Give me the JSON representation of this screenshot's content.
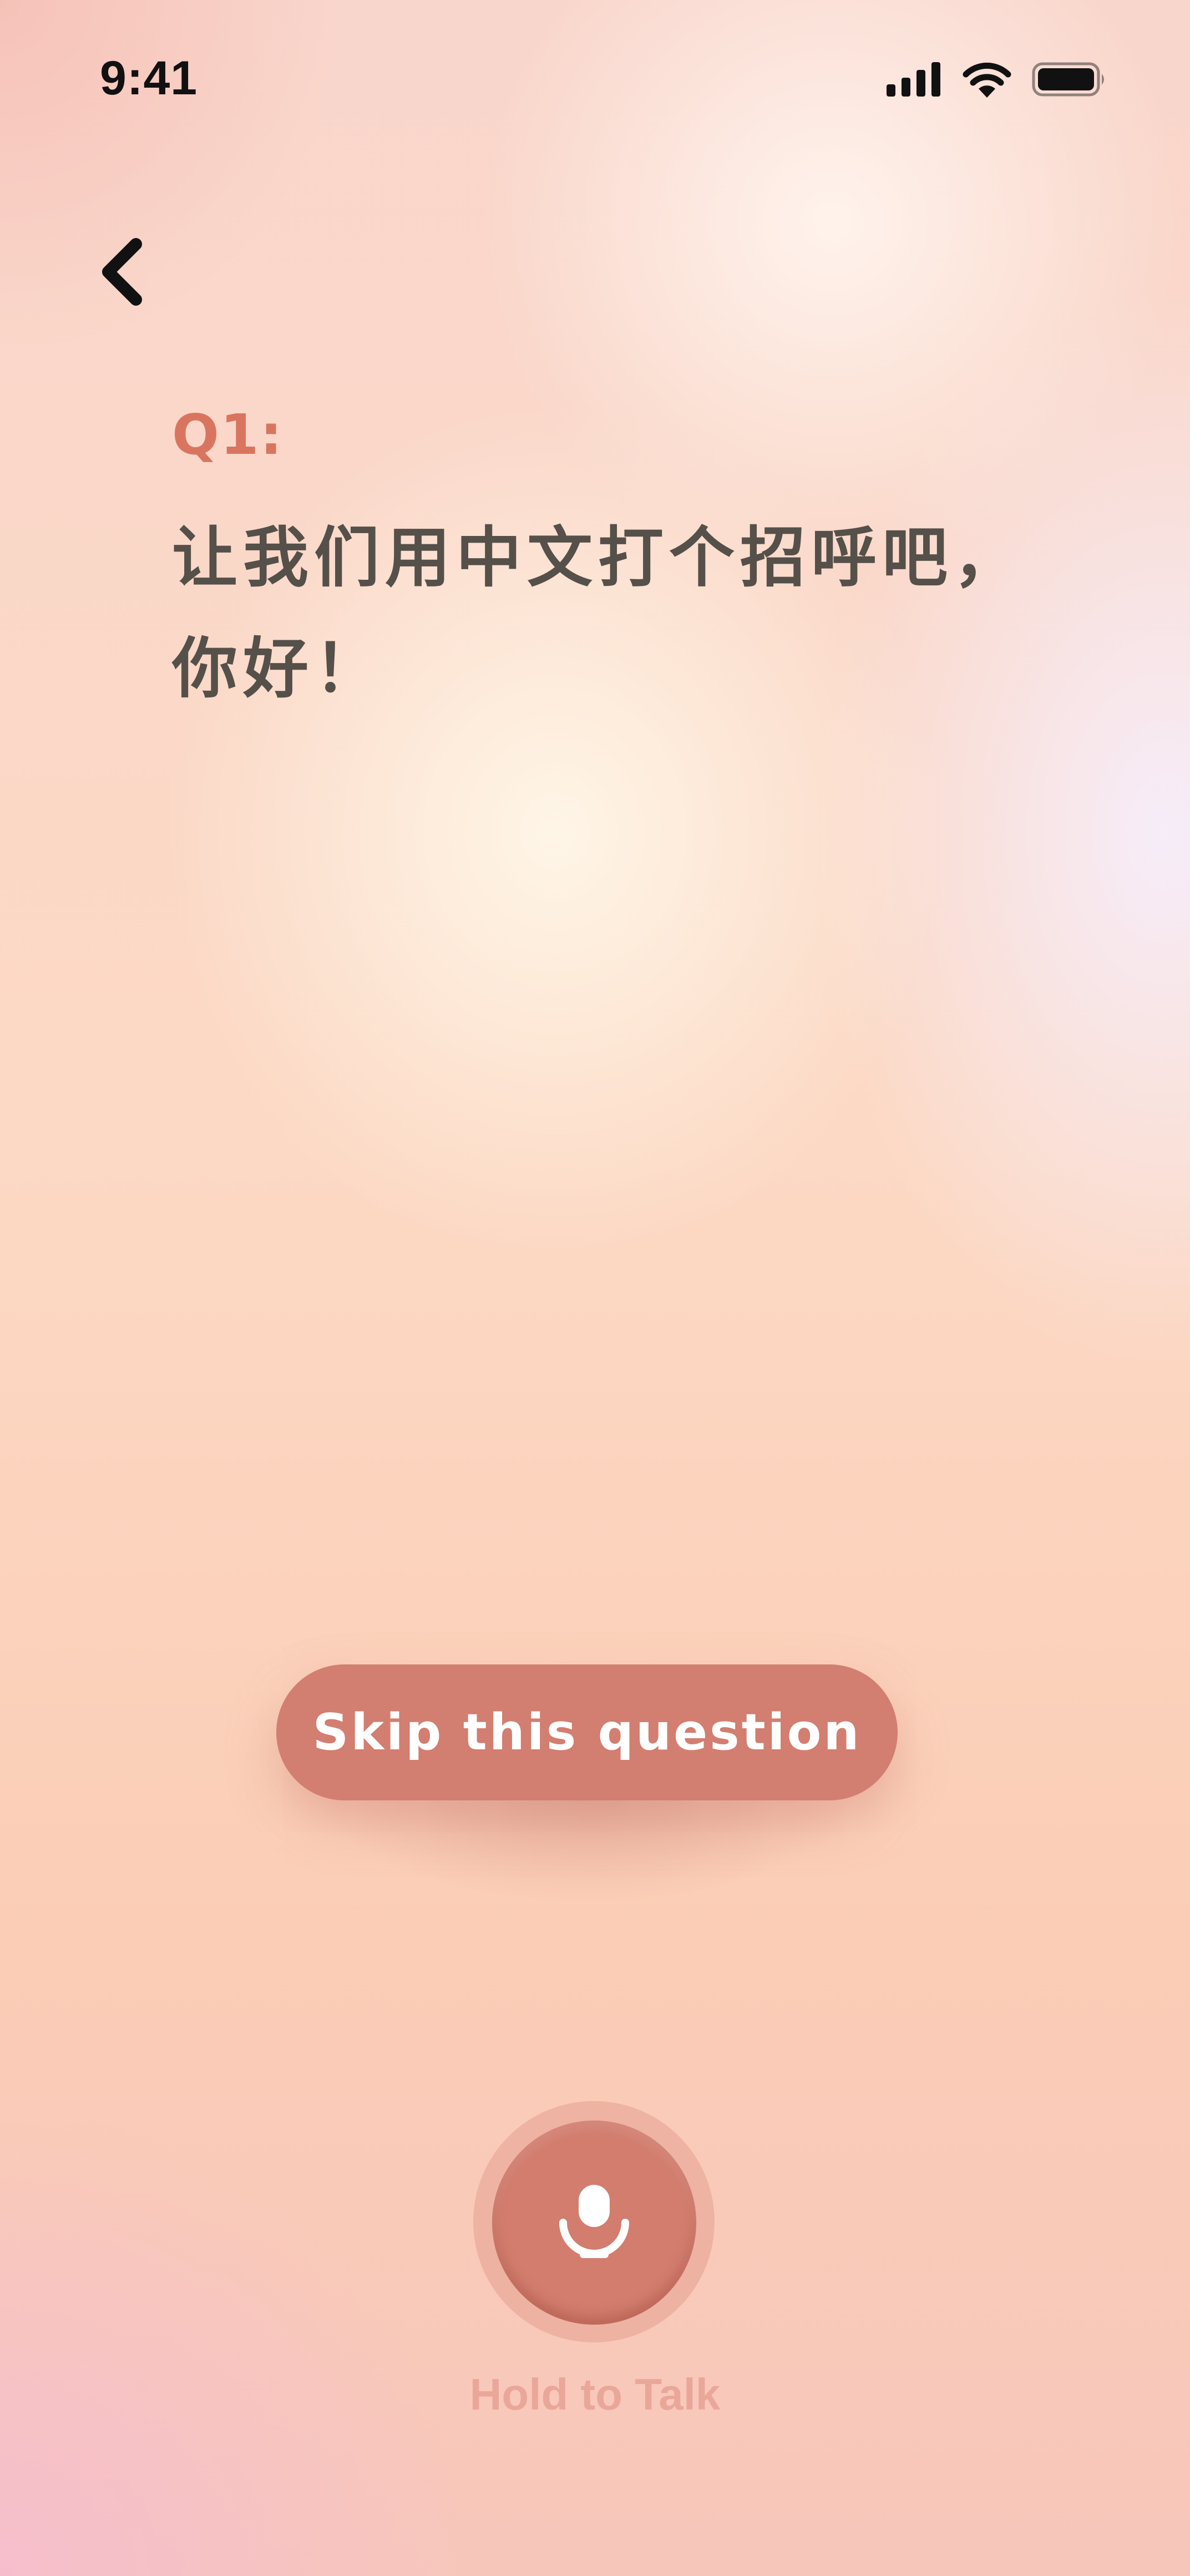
{
  "status_bar": {
    "time": "9:41",
    "icons": [
      "cellular-signal-icon",
      "wifi-icon",
      "battery-icon"
    ]
  },
  "navigation": {
    "back_icon": "chevron-left-icon"
  },
  "question": {
    "label": "Q1:",
    "line1": "让我们用中文打个招呼吧，",
    "line2": "你好！"
  },
  "skip_button": {
    "label": "Skip this question"
  },
  "mic": {
    "icon": "microphone-icon",
    "label": "Hold to Talk"
  },
  "colors": {
    "accent": "#d27e70",
    "question_label": "#d9755f",
    "question_text": "#555049",
    "hold_label": "#e9a79a"
  }
}
